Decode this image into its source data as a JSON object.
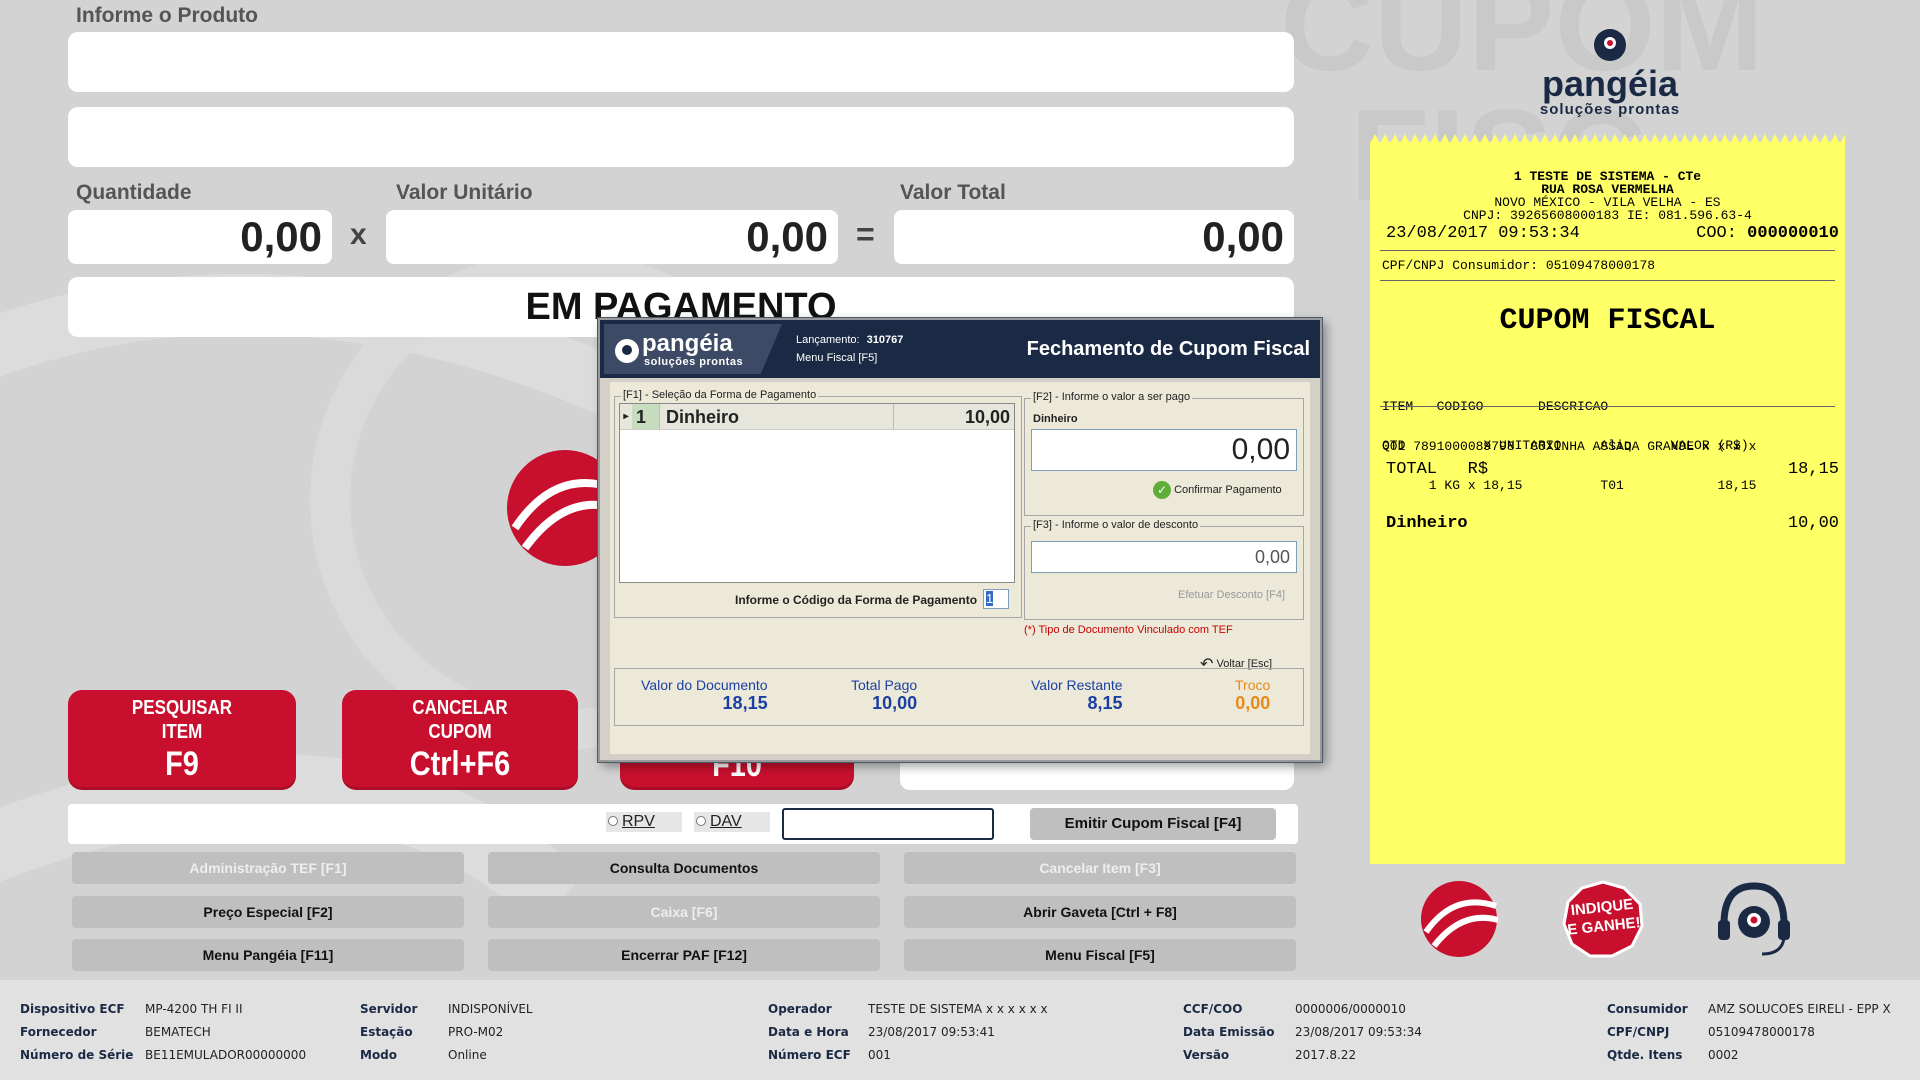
{
  "form": {
    "product_label": "Informe o Produto",
    "quantity_label": "Quantidade",
    "unit_value_label": "Valor Unitário",
    "total_value_label": "Valor Total",
    "quantity": "0,00",
    "unit_value": "0,00",
    "total_value": "0,00",
    "multiply_sign": "x",
    "equals_sign": "=",
    "status": "EM PAGAMENTO"
  },
  "buttons": {
    "search_item_l1": "PESQUISAR",
    "search_item_l2": "ITEM",
    "search_item_key": "F9",
    "cancel_coupon_l1": "CANCELAR",
    "cancel_coupon_l2": "CUPOM",
    "cancel_coupon_key": "Ctrl+F6",
    "third_key": "F10",
    "rpv": "RPV",
    "dav": "DAV",
    "emit_coupon": "Emitir Cupom Fiscal [F4]",
    "grid": [
      {
        "label": "Administração TEF [F1]",
        "enabled": false
      },
      {
        "label": "Consulta Documentos",
        "enabled": true
      },
      {
        "label": "Cancelar Item [F3]",
        "enabled": false
      },
      {
        "label": "Preço Especial [F2]",
        "enabled": true
      },
      {
        "label": "Caixa [F6]",
        "enabled": false
      },
      {
        "label": "Abrir Gaveta [Ctrl + F8]",
        "enabled": true
      },
      {
        "label": "Menu Pangéia [F11]",
        "enabled": true
      },
      {
        "label": "Encerrar PAF [F12]",
        "enabled": true
      },
      {
        "label": "Menu Fiscal [F5]",
        "enabled": true
      }
    ]
  },
  "brand": {
    "name": "pangéia",
    "tagline": "soluções prontas",
    "indique_l1": "INDIQUE",
    "indique_l2": "E GANHE!"
  },
  "receipt": {
    "l1": "1 TESTE DE SISTEMA - CTe",
    "l2": "RUA ROSA VERMELHA",
    "l3": "NOVO MÉXICO  -  VILA VELHA  - ES",
    "l4": "CNPJ: 39265608000183    IE: 081.596.63-4",
    "datetime": "23/08/2017 09:53:34",
    "coo_label": "COO:",
    "coo": "000000010",
    "consumer": "CPF/CNPJ Consumidor: 05109478000178",
    "title": "CUPOM FISCAL",
    "hdr1": "ITEM   CODIGO       DESCRICAO",
    "hdr2": "QTD          X UNITARIO     Aliq     VALOR (R$)",
    "item1": "001 7891000089798  COXINHA ASSADA GRANDE x x x x",
    "item2": "      1 KG x 18,15          T01            18,15",
    "total_label": "TOTAL   R$",
    "total_value": "18,15",
    "pay_label": "Dinheiro",
    "pay_value": "10,00"
  },
  "dialog": {
    "launch_label": "Lançamento:",
    "launch_number": "310767",
    "menu_fiscal": "Menu Fiscal [F5]",
    "title": "Fechamento de Cupom Fiscal",
    "f1_legend": "[F1] - Seleção da Forma de Pagamento",
    "payment_rows": [
      {
        "code": "1",
        "name": "Dinheiro",
        "value": "10,00"
      }
    ],
    "code_prompt": "Informe o Código da Forma de Pagamento",
    "code_value": "1",
    "f2_legend": "[F2] - Informe o valor a ser pago",
    "f2_method": "Dinheiro",
    "f2_value": "0,00",
    "confirm": "Confirmar Pagamento",
    "f3_legend": "[F3] - Informe o valor de desconto",
    "f3_value": "0,00",
    "discount_btn": "Efetuar Desconto [F4]",
    "tef_note": "(*) Tipo de Documento Vinculado com TEF",
    "back": "Voltar [Esc]",
    "doc_value_label": "Valor do Documento",
    "doc_value": "18,15",
    "paid_label": "Total Pago",
    "paid": "10,00",
    "remaining_label": "Valor Restante",
    "remaining": "8,15",
    "change_label": "Troco",
    "change": "0,00",
    "colors": {
      "dark": "#1b2a44",
      "blue": "#1c3fa3",
      "orange": "#e88a1a",
      "red": "#cc0000"
    }
  },
  "footer": {
    "device_ecf_k": "Dispositivo ECF",
    "device_ecf_v": "MP-4200 TH FI II",
    "supplier_k": "Fornecedor",
    "supplier_v": "BEMATECH",
    "serial_k": "Número de Série",
    "serial_v": "BE11EMULADOR00000000",
    "server_k": "Servidor",
    "server_v": "INDISPONÍVEL",
    "station_k": "Estação",
    "station_v": "PRO-M02",
    "mode_k": "Modo",
    "mode_v": "Online",
    "operator_k": "Operador",
    "operator_v": "TESTE DE SISTEMA x x x x x x",
    "datetime_k": "Data e Hora",
    "datetime_v": "23/08/2017 09:53:41",
    "ecf_num_k": "Número ECF",
    "ecf_num_v": "001",
    "ccf_k": "CCF/COO",
    "ccf_v": "0000006/0000010",
    "emission_k": "Data Emissão",
    "emission_v": "23/08/2017 09:53:34",
    "version_k": "Versão",
    "version_v": "2017.8.22",
    "consumer_k": "Consumidor",
    "consumer_v": "AMZ SOLUCOES EIRELI - EPP X",
    "cpf_k": "CPF/CNPJ",
    "cpf_v": "05109478000178",
    "items_k": "Qtde. Itens",
    "items_v": "0002"
  }
}
